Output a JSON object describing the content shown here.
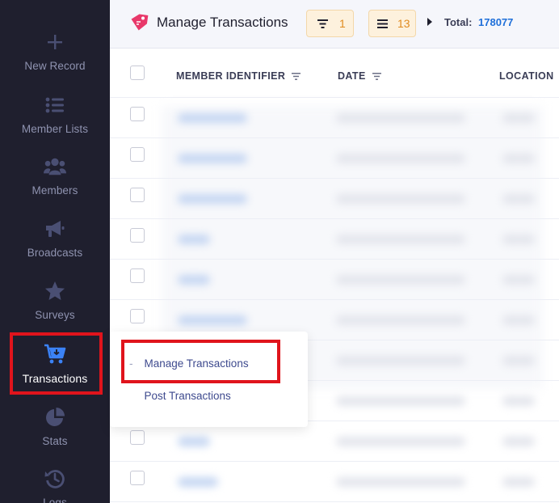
{
  "sidebar": {
    "items": [
      {
        "label": "New Record",
        "icon": "plus-icon"
      },
      {
        "label": "Member Lists",
        "icon": "list-icon"
      },
      {
        "label": "Members",
        "icon": "users-icon"
      },
      {
        "label": "Broadcasts",
        "icon": "megaphone-icon"
      },
      {
        "label": "Surveys",
        "icon": "star-icon"
      },
      {
        "label": "Transactions",
        "icon": "cart-icon",
        "active": true
      },
      {
        "label": "Stats",
        "icon": "pie-chart-icon"
      },
      {
        "label": "Logs",
        "icon": "history-icon"
      }
    ]
  },
  "header": {
    "title": "Manage Transactions",
    "title_icon": "tag-icon",
    "filter_count": "1",
    "columns_count": "13",
    "total_label": "Total:",
    "total_value": "178077"
  },
  "table": {
    "columns": [
      "MEMBER IDENTIFIER",
      "DATE",
      "LOCATION"
    ],
    "row_count_visible": 10
  },
  "submenu": {
    "items": [
      {
        "label": "Manage Transactions",
        "highlighted": true
      },
      {
        "label": "Post Transactions"
      }
    ],
    "dash": "-"
  },
  "colors": {
    "sidebar_bg": "#1f1f2e",
    "sidebar_text": "#8f93b0",
    "accent_blue": "#1e6fd9",
    "highlight_red": "#e0141c",
    "chip_orange": "#e08a1e",
    "brand_pink": "#e8386a"
  }
}
